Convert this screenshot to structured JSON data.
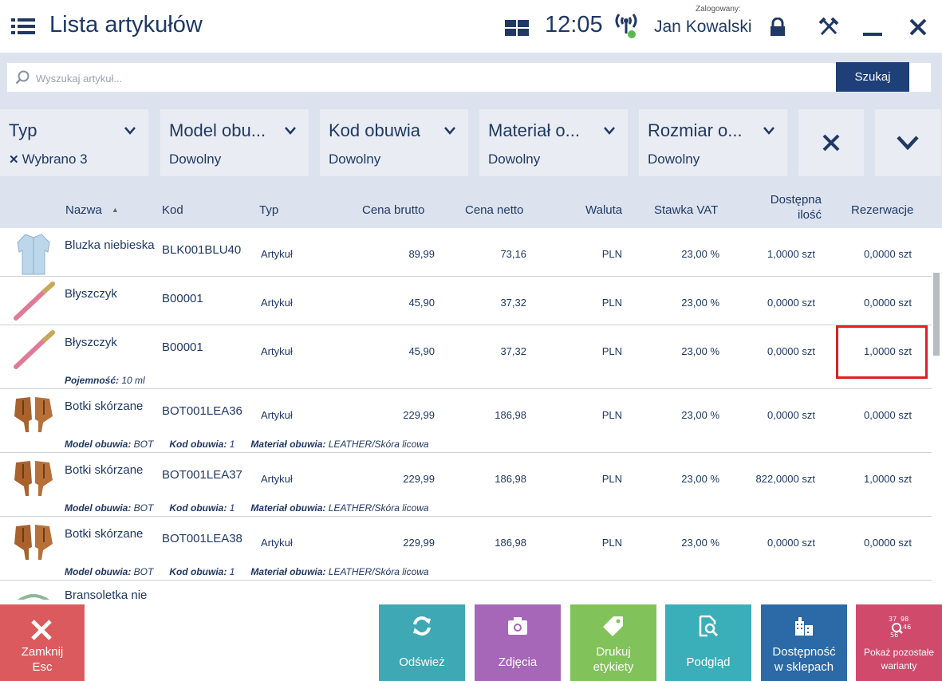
{
  "header": {
    "title": "Lista artykułów",
    "time": "12:05",
    "logged_label": "Zalogowany:",
    "user": "Jan Kowalski"
  },
  "search": {
    "placeholder": "Wyszukaj artykuł...",
    "button": "Szukaj"
  },
  "filters": [
    {
      "title": "Typ",
      "value": "Wybrano 3"
    },
    {
      "title": "Model obu...",
      "value": "Dowolny"
    },
    {
      "title": "Kod obuwia",
      "value": "Dowolny"
    },
    {
      "title": "Materiał o...",
      "value": "Dowolny"
    },
    {
      "title": "Rozmiar o...",
      "value": "Dowolny"
    }
  ],
  "table": {
    "columns": [
      "Nazwa",
      "Kod",
      "Typ",
      "Cena brutto",
      "Cena netto",
      "Waluta",
      "Stawka VAT",
      "Dostępna ilość",
      "Rezerwacje"
    ],
    "column_line1": "Dostępna",
    "column_line2": "ilość",
    "rows": [
      {
        "name": "Bluzka niebieska",
        "code": "BLK001BLU40",
        "type": "Artykuł",
        "gross": "89,99",
        "net": "73,16",
        "currency": "PLN",
        "vat": "23,00 %",
        "qty": "1,0000 szt",
        "reserved": "0,0000 szt"
      },
      {
        "name": "Błyszczyk",
        "code": "B00001",
        "type": "Artykuł",
        "gross": "45,90",
        "net": "37,32",
        "currency": "PLN",
        "vat": "23,00 %",
        "qty": "0,0000 szt",
        "reserved": "0,0000 szt"
      },
      {
        "name": "Błyszczyk",
        "code": "B00001",
        "type": "Artykuł",
        "gross": "45,90",
        "net": "37,32",
        "currency": "PLN",
        "vat": "23,00 %",
        "qty": "0,0000 szt",
        "reserved": "1,0000 szt",
        "attr1_label": "Pojemność:",
        "attr1_value": "10 ml"
      },
      {
        "name": "Botki skórzane",
        "code": "BOT001LEA36",
        "type": "Artykuł",
        "gross": "229,99",
        "net": "186,98",
        "currency": "PLN",
        "vat": "23,00 %",
        "qty": "0,0000 szt",
        "reserved": "0,0000 szt",
        "attr1_label": "Model obuwia:",
        "attr1_value": "BOT",
        "attr2_label": "Kod obuwia:",
        "attr2_value": "1",
        "attr3_label": "Materiał obuwia:",
        "attr3_value": "LEATHER/Skóra licowa"
      },
      {
        "name": "Botki skórzane",
        "code": "BOT001LEA37",
        "type": "Artykuł",
        "gross": "229,99",
        "net": "186,98",
        "currency": "PLN",
        "vat": "23,00 %",
        "qty": "822,0000 szt",
        "reserved": "1,0000 szt",
        "attr1_label": "Model obuwia:",
        "attr1_value": "BOT",
        "attr2_label": "Kod obuwia:",
        "attr2_value": "1",
        "attr3_label": "Materiał obuwia:",
        "attr3_value": "LEATHER/Skóra licowa"
      },
      {
        "name": "Botki skórzane",
        "code": "BOT001LEA38",
        "type": "Artykuł",
        "gross": "229,99",
        "net": "186,98",
        "currency": "PLN",
        "vat": "23,00 %",
        "qty": "0,0000 szt",
        "reserved": "0,0000 szt",
        "attr1_label": "Model obuwia:",
        "attr1_value": "BOT",
        "attr2_label": "Kod obuwia:",
        "attr2_value": "1",
        "attr3_label": "Materiał obuwia:",
        "attr3_value": "LEATHER/Skóra licowa"
      },
      {
        "name": "Bransoletka nie"
      }
    ]
  },
  "bottom_bar": {
    "close": {
      "line1": "Zamknij",
      "line2": "Esc"
    },
    "refresh": "Odśwież",
    "photos": "Zdjęcia",
    "print": {
      "line1": "Drukuj",
      "line2": "etykiety"
    },
    "preview": "Podgląd",
    "availability": {
      "line1": "Dostępność",
      "line2": "w sklepach"
    },
    "variants": {
      "line1": "Pokaż pozostałe",
      "line2": "warianty"
    }
  },
  "colors": {
    "primary": "#1f3864",
    "search_button": "#1e3f78",
    "close": "#db5a5e",
    "refresh": "#3ea8b4",
    "photos": "#a667b8",
    "print": "#82c25a",
    "preview": "#3aaeb9",
    "availability": "#2b6aa6",
    "variants": "#d04a6c",
    "highlight": "#e11f1f"
  }
}
